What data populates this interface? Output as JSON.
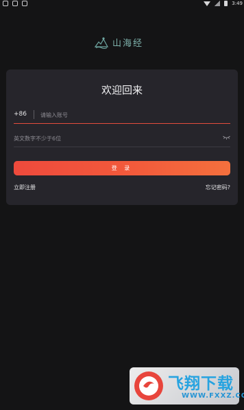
{
  "status_bar": {
    "time": "3:49"
  },
  "logo": {
    "text": "山海经"
  },
  "login": {
    "title": "欢迎回来",
    "country_code": "+86",
    "account_placeholder": "请输入账号",
    "password_placeholder": "英文数字不少于6位",
    "login_button": "登 录",
    "register_link": "立即注册",
    "forgot_link": "忘记密码?"
  },
  "watermark": {
    "brand": "飞翔下载",
    "url": "WWW.FXXZ.COM"
  },
  "colors": {
    "background": "#141415",
    "card": "#26252b",
    "accent": "#ef4d3c",
    "logo": "#7fb3ad"
  }
}
